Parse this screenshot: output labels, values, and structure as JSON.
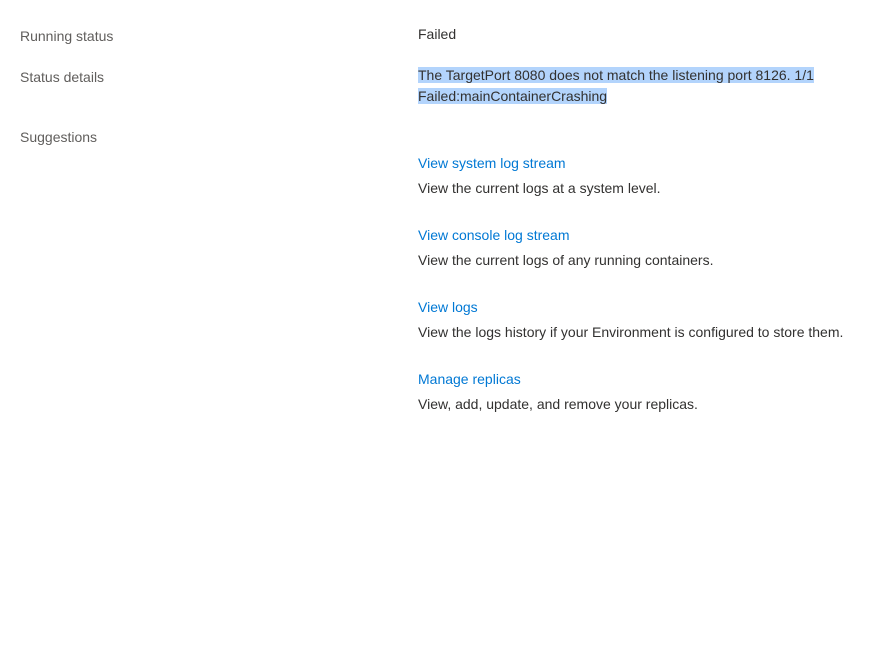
{
  "rows": {
    "running_status": {
      "label": "Running status",
      "value": "Failed"
    },
    "status_details": {
      "label": "Status details",
      "value": "The TargetPort 8080 does not match the listening port 8126. 1/1 Failed:mainContainerCrashing"
    },
    "suggestions_label": "Suggestions"
  },
  "suggestions": [
    {
      "link": "View system log stream",
      "desc": "View the current logs at a system level."
    },
    {
      "link": "View console log stream",
      "desc": "View the current logs of any running containers."
    },
    {
      "link": "View logs",
      "desc": "View the logs history if your Environment is configured to store them."
    },
    {
      "link": "Manage replicas",
      "desc": "View, add, update, and remove your replicas."
    }
  ]
}
